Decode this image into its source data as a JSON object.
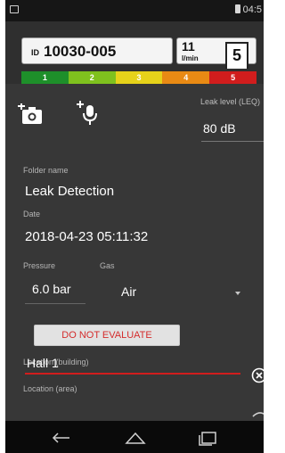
{
  "status_bar": {
    "time": "04:5"
  },
  "header": {
    "id_prefix": "ID",
    "id_value": "10030-005",
    "flow_value": "11",
    "flow_unit": "l/min",
    "leak_class": "5"
  },
  "scale": {
    "labels": [
      "1",
      "2",
      "3",
      "4",
      "5"
    ],
    "active_class": 5,
    "colors": [
      "#1e8f2a",
      "#7fc11e",
      "#e6d21a",
      "#e98a14",
      "#d11d1d"
    ]
  },
  "actions": {
    "camera_icon": "add-photo-icon",
    "mic_icon": "add-voice-icon"
  },
  "leak_level": {
    "label": "Leak level (LEQ)",
    "value": "80 dB"
  },
  "folder": {
    "label": "Folder name",
    "value": "Leak Detection"
  },
  "date": {
    "label": "Date",
    "value": "2018-04-23 05:11:32"
  },
  "pressure": {
    "label": "Pressure",
    "value": "6.0 bar"
  },
  "gas": {
    "label": "Gas",
    "value": "Air"
  },
  "evaluate_button": {
    "label": "DO NOT EVALUATE"
  },
  "location_building": {
    "label": "Location (building)",
    "value": "Hall 1"
  },
  "location_area": {
    "label": "Location (area)"
  },
  "nav": {
    "back_icon": "back-icon",
    "home_icon": "home-icon",
    "recents_icon": "recents-icon"
  }
}
